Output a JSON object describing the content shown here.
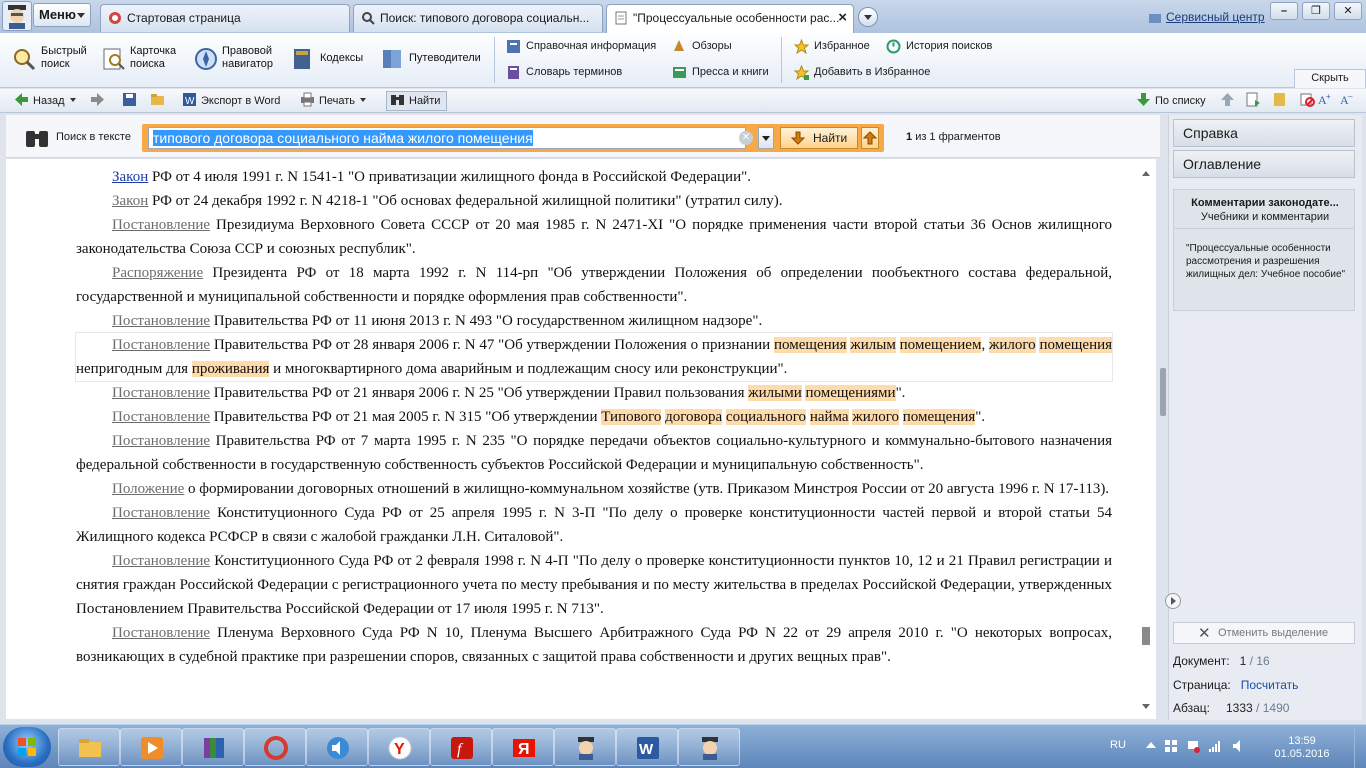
{
  "menu_label": "Меню",
  "tabs": [
    {
      "label": "Стартовая страница"
    },
    {
      "label": "Поиск: типового договора социальн..."
    },
    {
      "label": "\"Процессуальные особенности рас..."
    }
  ],
  "service_center": "Сервисный центр",
  "window_buttons": [
    "–",
    "❐",
    "✕"
  ],
  "ribbon": {
    "quick_search": "Быстрый поиск",
    "card_search": "Карточка поиска",
    "legal_navigator": "Правовой навигатор",
    "codes": "Кодексы",
    "guides": "Путеводители",
    "reference_info": "Справочная информация",
    "glossary": "Словарь терминов",
    "reviews": "Обзоры",
    "press_books": "Пресса и книги",
    "favorites": "Избранное",
    "add_favorites": "Добавить в Избранное",
    "search_history": "История поисков",
    "collapse": "Скрыть"
  },
  "toolbar": {
    "back": "Назад",
    "export_word": "Экспорт в Word",
    "print": "Печать",
    "find": "Найти",
    "by_list": "По списку"
  },
  "search": {
    "label": "Поиск в тексте",
    "query": "типового договора социального найма жилого помещения",
    "find_button": "Найти",
    "count_current": "1",
    "count_text": "из 1 фрагментов"
  },
  "document": {
    "p1": {
      "link": "Закон",
      "text": " РФ от 4 июля 1991 г. N 1541-1 \"О приватизации жилищного фонда в Российской Федерации\"."
    },
    "p2": {
      "link": "Закон",
      "text": " РФ от 24 декабря 1992 г. N 4218-1 \"Об основах федеральной жилищной политики\" (утратил силу)."
    },
    "p3": {
      "link": "Постановление",
      "text": " Президиума Верховного Совета СССР от 20 мая 1985 г. N 2471-XI \"О порядке применения части второй статьи 36 Основ жилищного законодательства Союза ССР и союзных республик\"."
    },
    "p4": {
      "link": "Распоряжение",
      "text": " Президента РФ от 18 марта 1992 г. N 114-рп \"Об утверждении Положения об определении пообъектного состава федеральной, государственной и муниципальной собственности и порядке оформления прав собственности\"."
    },
    "p5": {
      "link": "Постановление",
      "text": " Правительства РФ от 11 июня 2013 г. N 493 \"О государственном жилищном надзоре\"."
    },
    "p6": {
      "link": "Постановление",
      "t1": " Правительства РФ от 28 января 2006 г. N 47 \"Об утверждении Положения о признании ",
      "h1": "помещения",
      "h2": "жилым",
      "h3": "помещением",
      "t2": ", ",
      "h4": "жилого",
      "h5": "помещения",
      "t3": " непригодным для ",
      "h6": "проживания",
      "t4": " и многоквартирного дома аварийным и подлежащим сносу или реконструкции\"."
    },
    "p7": {
      "link": "Постановление",
      "t1": " Правительства РФ от 21 января 2006 г. N 25 \"Об утверждении Правил пользования ",
      "h1": "жилыми",
      "h2": "помещениями",
      "t2": "\"."
    },
    "p8": {
      "link": "Постановление",
      "t1": " Правительства РФ от 21 мая 2005 г. N 315 \"Об утверждении ",
      "h1": "Типового",
      "h2": "договора",
      "h3": "социального",
      "h4": "найма",
      "h5": "жилого",
      "h6": "помещения",
      "t2": "\"."
    },
    "p9": {
      "link": "Постановление",
      "text": " Правительства РФ от 7 марта 1995 г. N 235 \"О порядке передачи объектов социально-культурного и коммунально-бытового назначения федеральной собственности в государственную собственность субъектов Российской Федерации и муниципальную собственность\"."
    },
    "p10": {
      "link": "Положение",
      "text": " о формировании договорных отношений в жилищно-коммунальном хозяйстве (утв. Приказом Минстроя России от 20 августа 1996 г. N 17-113)."
    },
    "p11": {
      "link": "Постановление",
      "text": " Конституционного Суда РФ от 25 апреля 1995 г. N 3-П \"По делу о проверке конституционности частей первой и второй статьи 54 Жилищного кодекса РСФСР в связи с жалобой гражданки Л.Н. Ситаловой\"."
    },
    "p12": {
      "link": "Постановление",
      "text": " Конституционного Суда РФ от 2 февраля 1998 г. N 4-П \"По делу о проверке конституционности пунктов 10, 12 и 21 Правил регистрации и снятия граждан Российской Федерации с регистрационного учета по месту пребывания и по месту жительства в пределах Российской Федерации, утвержденных Постановлением Правительства Российской Федерации от 17 июля 1995 г. N 713\"."
    },
    "p13": {
      "link": "Постановление",
      "text": " Пленума Верховного Суда РФ N 10, Пленума Высшего Арбитражного Суда РФ N 22 от 29 апреля 2010 г. \"О некоторых вопросах, возникающих в судебной практике при разрешении споров, связанных с защитой права собственности и других вещных прав\"."
    }
  },
  "right_panel": {
    "help": "Справка",
    "contents": "Оглавление",
    "card_title": "Комментарии законодате...",
    "card_subtitle": "Учебники и комментарии",
    "card_body": "\"Процессуальные особенности рассмотрения и разрешения жилищных дел: Учебное пособие\"",
    "cancel_selection": "Отменить выделение",
    "doc_label": "Документ:",
    "doc_current": "1",
    "doc_total": "/ 16",
    "page_label": "Страница:",
    "page_value": "Посчитать",
    "para_label": "Абзац:",
    "para_current": "1333",
    "para_total": "/ 1490"
  },
  "taskbar": {
    "lang": "RU",
    "time": "13:59",
    "date": "01.05.2016"
  }
}
